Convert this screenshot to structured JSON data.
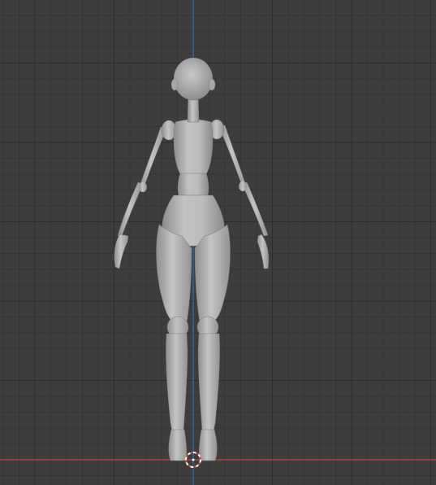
{
  "viewport": {
    "view": "front-orthographic",
    "background_color": "#3d3d3d",
    "grid": {
      "visible": true,
      "minor_line_color": "#353535",
      "major_line_color": "#2d2d2d"
    },
    "axes": {
      "x_axis_color": "#c0443f",
      "z_axis_color": "#2f6fb6"
    },
    "scene_objects": [
      {
        "name": "human-mannequin-mesh",
        "type": "mesh",
        "shading": "solid",
        "color": "#b7b7b7"
      },
      {
        "name": "3d-cursor",
        "type": "cursor",
        "ring_colors": [
          "#ffffff",
          "#d8453c"
        ]
      }
    ]
  }
}
